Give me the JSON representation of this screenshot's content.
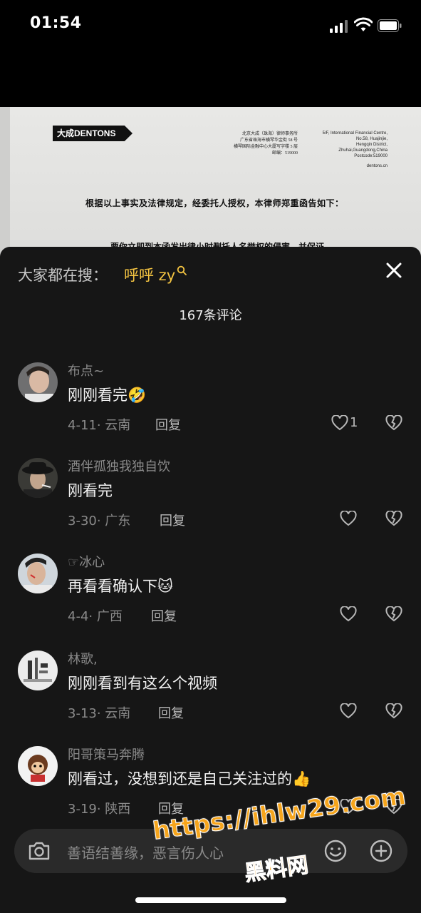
{
  "status_bar": {
    "time": "01:54"
  },
  "document": {
    "logo_text": "大成DENTONS",
    "address_cn": [
      "北京大成（珠海）律师事务所",
      "广东省珠海市横琴华金街 58 号",
      "横琴国际金融中心大厦写字楼 5 层",
      "邮编：519000"
    ],
    "address_en": [
      "5/F, International Financial Centre,",
      "No.58, Huajinjie,",
      "Hengqin District,",
      "Zhuhai,Guangdong,China",
      "Postcode:519000"
    ],
    "website": "dentons.cn",
    "line1": "根据以上事实及法律规定，经委托人授权，本律师郑重函告如下：",
    "line2": "要你立即到本函发出律小时删托人名誉权的侵害，并保证"
  },
  "sheet": {
    "hot_search_label": "大家都在搜：",
    "hot_search_query": "呼呼 zy",
    "comment_count": "167条评论"
  },
  "comments": [
    {
      "username": "布点~",
      "text": "刚刚看完",
      "emoji": "🤣",
      "date_location": "4-11· 云南",
      "reply": "回复",
      "likes": "1"
    },
    {
      "username": "酒伴孤独我独自饮",
      "text": "刚看完",
      "emoji": "",
      "date_location": "3-30· 广东",
      "reply": "回复",
      "likes": ""
    },
    {
      "username": "☞冰心",
      "text": "再看看确认下",
      "emoji": "🐱",
      "date_location": "4-4· 广西",
      "reply": "回复",
      "likes": ""
    },
    {
      "username": "林歌,",
      "text": "刚刚看到有这么个视频",
      "emoji": "",
      "date_location": "3-13· 云南",
      "reply": "回复",
      "likes": ""
    },
    {
      "username": "阳哥策马奔腾",
      "text": "刚看过，没想到还是自己关注过的",
      "emoji": "👍",
      "date_location": "3-19· 陕西",
      "reply": "回复",
      "likes": ""
    }
  ],
  "input": {
    "placeholder": "善语结善缘，恶言伤人心"
  },
  "watermark": {
    "url": "https://ihlw29.com",
    "name": "黑料网"
  },
  "icons": [
    "signal-icon",
    "wifi-icon",
    "battery-icon",
    "search-icon",
    "close-icon",
    "heart-icon",
    "broken-heart-icon",
    "camera-icon",
    "emoji-icon",
    "plus-icon"
  ],
  "colors": {
    "accent": "#f5c542",
    "sheet_bg": "#161616",
    "watermark": "#f6a51c"
  }
}
